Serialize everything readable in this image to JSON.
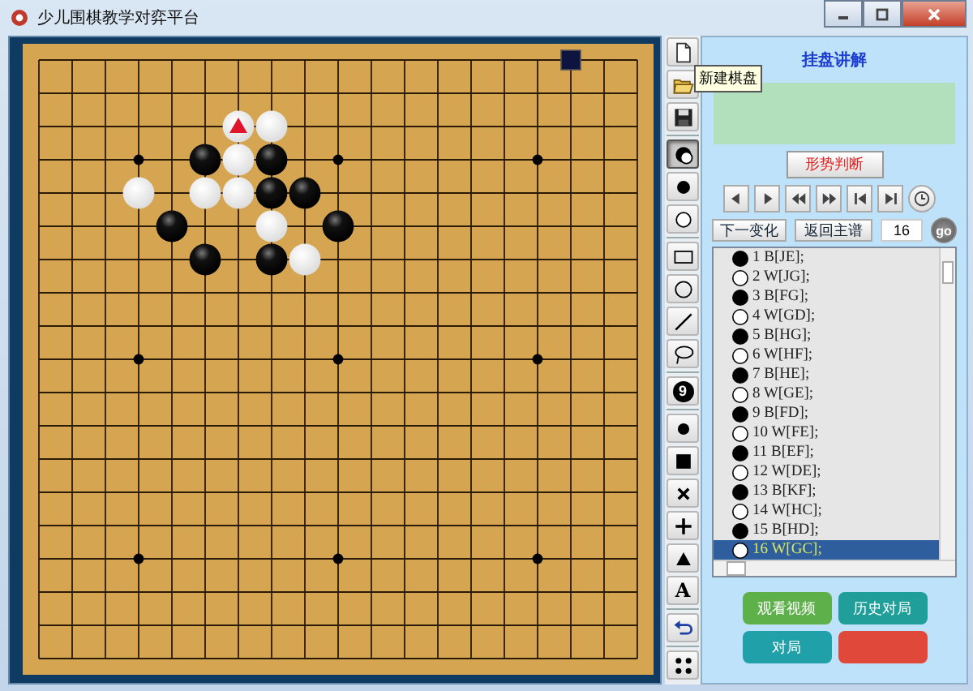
{
  "window": {
    "title": "少儿围棋教学对弈平台"
  },
  "board": {
    "rows": [
      [
        {
          "kind": "empty"
        },
        {
          "kind": "empty"
        },
        {
          "kind": "empty"
        },
        {
          "kind": "empty"
        },
        {
          "kind": "empty"
        },
        {
          "kind": "empty"
        },
        {
          "kind": "empty"
        },
        {
          "kind": "empty"
        },
        {
          "kind": "empty"
        },
        {
          "kind": "empty"
        },
        {
          "kind": "empty"
        },
        {
          "kind": "empty"
        },
        {
          "kind": "empty"
        },
        {
          "kind": "empty"
        },
        {
          "kind": "empty"
        },
        {
          "kind": "empty"
        },
        {
          "kind": "square"
        },
        {
          "kind": "empty"
        },
        {
          "kind": "empty"
        }
      ],
      [
        {
          "kind": "empty"
        },
        {
          "kind": "empty"
        },
        {
          "kind": "empty"
        },
        {
          "kind": "empty"
        },
        {
          "kind": "empty"
        },
        {
          "kind": "empty"
        },
        {
          "kind": "empty"
        },
        {
          "kind": "empty"
        },
        {
          "kind": "empty"
        },
        {
          "kind": "empty"
        },
        {
          "kind": "empty"
        },
        {
          "kind": "empty"
        },
        {
          "kind": "empty"
        },
        {
          "kind": "empty"
        },
        {
          "kind": "empty"
        },
        {
          "kind": "empty"
        },
        {
          "kind": "empty"
        },
        {
          "kind": "empty"
        },
        {
          "kind": "empty"
        }
      ],
      [
        {
          "kind": "empty"
        },
        {
          "kind": "empty"
        },
        {
          "kind": "empty"
        },
        {
          "kind": "empty"
        },
        {
          "kind": "empty"
        },
        {
          "kind": "empty"
        },
        {
          "kind": "white",
          "marked": true
        },
        {
          "kind": "white",
          "marked": false
        },
        {
          "kind": "empty"
        },
        {
          "kind": "empty"
        },
        {
          "kind": "empty"
        },
        {
          "kind": "empty"
        },
        {
          "kind": "empty"
        },
        {
          "kind": "empty"
        },
        {
          "kind": "empty"
        },
        {
          "kind": "empty"
        },
        {
          "kind": "empty"
        },
        {
          "kind": "empty"
        },
        {
          "kind": "empty"
        }
      ],
      [
        {
          "kind": "empty"
        },
        {
          "kind": "empty"
        },
        {
          "kind": "empty"
        },
        {
          "kind": "empty"
        },
        {
          "kind": "empty"
        },
        {
          "kind": "black",
          "marked": false
        },
        {
          "kind": "white",
          "marked": false
        },
        {
          "kind": "black",
          "marked": false
        },
        {
          "kind": "empty"
        },
        {
          "kind": "empty"
        },
        {
          "kind": "empty"
        },
        {
          "kind": "empty"
        },
        {
          "kind": "empty"
        },
        {
          "kind": "empty"
        },
        {
          "kind": "empty"
        },
        {
          "kind": "empty"
        },
        {
          "kind": "empty"
        },
        {
          "kind": "empty"
        },
        {
          "kind": "empty"
        }
      ],
      [
        {
          "kind": "empty"
        },
        {
          "kind": "empty"
        },
        {
          "kind": "empty"
        },
        {
          "kind": "white",
          "marked": false
        },
        {
          "kind": "empty"
        },
        {
          "kind": "white",
          "marked": false
        },
        {
          "kind": "white",
          "marked": false
        },
        {
          "kind": "black",
          "marked": false
        },
        {
          "kind": "black",
          "marked": false
        },
        {
          "kind": "empty"
        },
        {
          "kind": "empty"
        },
        {
          "kind": "empty"
        },
        {
          "kind": "empty"
        },
        {
          "kind": "empty"
        },
        {
          "kind": "empty"
        },
        {
          "kind": "empty"
        },
        {
          "kind": "empty"
        },
        {
          "kind": "empty"
        },
        {
          "kind": "empty"
        }
      ],
      [
        {
          "kind": "empty"
        },
        {
          "kind": "empty"
        },
        {
          "kind": "empty"
        },
        {
          "kind": "empty"
        },
        {
          "kind": "black",
          "marked": false
        },
        {
          "kind": "empty"
        },
        {
          "kind": "empty"
        },
        {
          "kind": "white",
          "marked": false
        },
        {
          "kind": "empty"
        },
        {
          "kind": "black",
          "marked": false
        },
        {
          "kind": "empty"
        },
        {
          "kind": "empty"
        },
        {
          "kind": "empty"
        },
        {
          "kind": "empty"
        },
        {
          "kind": "empty"
        },
        {
          "kind": "empty"
        },
        {
          "kind": "empty"
        },
        {
          "kind": "empty"
        },
        {
          "kind": "empty"
        }
      ],
      [
        {
          "kind": "empty"
        },
        {
          "kind": "empty"
        },
        {
          "kind": "empty"
        },
        {
          "kind": "empty"
        },
        {
          "kind": "empty"
        },
        {
          "kind": "black",
          "marked": false
        },
        {
          "kind": "empty"
        },
        {
          "kind": "black",
          "marked": false
        },
        {
          "kind": "white",
          "marked": false
        },
        {
          "kind": "empty"
        },
        {
          "kind": "empty"
        },
        {
          "kind": "empty"
        },
        {
          "kind": "empty"
        },
        {
          "kind": "empty"
        },
        {
          "kind": "empty"
        },
        {
          "kind": "empty"
        },
        {
          "kind": "empty"
        },
        {
          "kind": "empty"
        },
        {
          "kind": "empty"
        }
      ]
    ]
  },
  "toolbar": [
    [
      {
        "kind": "new",
        "selected": false
      },
      {
        "kind": "open",
        "selected": false
      },
      {
        "kind": "save",
        "selected": false
      }
    ],
    [
      {
        "kind": "toggle",
        "selected": true
      },
      {
        "kind": "black",
        "selected": false
      },
      {
        "kind": "white",
        "selected": false
      }
    ],
    [
      {
        "kind": "rectangle",
        "selected": false
      },
      {
        "kind": "circle",
        "selected": false
      },
      {
        "kind": "line",
        "selected": false
      },
      {
        "kind": "lasso",
        "selected": false
      }
    ],
    [
      {
        "kind": "number",
        "label": "9",
        "selected": false
      }
    ],
    [
      {
        "kind": "dot",
        "selected": false
      },
      {
        "kind": "square",
        "selected": false
      },
      {
        "kind": "cross",
        "selected": false
      },
      {
        "kind": "plus",
        "selected": false
      },
      {
        "kind": "triangle",
        "selected": false
      },
      {
        "kind": "text",
        "label": "A",
        "selected": false
      }
    ],
    [
      {
        "kind": "undo",
        "selected": false
      }
    ],
    [
      {
        "kind": "grid",
        "selected": false
      }
    ]
  ],
  "tooltip": {
    "text": "新建棋盘"
  },
  "panel": {
    "title": "挂盘讲解",
    "judge_button": "形势判断",
    "nav_buttons": [
      {
        "kind": "prev"
      },
      {
        "kind": "next"
      },
      {
        "kind": "rewind"
      },
      {
        "kind": "forward"
      },
      {
        "kind": "first"
      },
      {
        "kind": "last"
      },
      {
        "kind": "clock"
      }
    ],
    "variation_button": "下一变化",
    "main_button": "返回主谱",
    "move_field": {
      "value": "16"
    },
    "go_button": "go",
    "moves": [
      {
        "text": "1 B[JE];",
        "kind": "black",
        "selected": false
      },
      {
        "text": "2 W[JG];",
        "kind": "white",
        "selected": false
      },
      {
        "text": "3 B[FG];",
        "kind": "black",
        "selected": false
      },
      {
        "text": "4 W[GD];",
        "kind": "white",
        "selected": false
      },
      {
        "text": "5 B[HG];",
        "kind": "black",
        "selected": false
      },
      {
        "text": "6 W[HF];",
        "kind": "white",
        "selected": false
      },
      {
        "text": "7 B[HE];",
        "kind": "black",
        "selected": false
      },
      {
        "text": "8 W[GE];",
        "kind": "white",
        "selected": false
      },
      {
        "text": "9 B[FD];",
        "kind": "black",
        "selected": false
      },
      {
        "text": "10 W[FE];",
        "kind": "white",
        "selected": false
      },
      {
        "text": "11 B[EF];",
        "kind": "black",
        "selected": false
      },
      {
        "text": "12 W[DE];",
        "kind": "white",
        "selected": false
      },
      {
        "text": "13 B[KF];",
        "kind": "black",
        "selected": false
      },
      {
        "text": "14 W[HC];",
        "kind": "white",
        "selected": false
      },
      {
        "text": "15 B[HD];",
        "kind": "black",
        "selected": false
      },
      {
        "text": "16 W[GC];",
        "kind": "white",
        "selected": true
      }
    ],
    "bottom_buttons": [
      {
        "label": "观看视频",
        "color": "#5db04a"
      },
      {
        "label": "历史对局",
        "color": "#1f9e9a"
      },
      {
        "label": "对局",
        "color": "#20a0a8"
      },
      {
        "color": "#e0483a"
      }
    ]
  }
}
